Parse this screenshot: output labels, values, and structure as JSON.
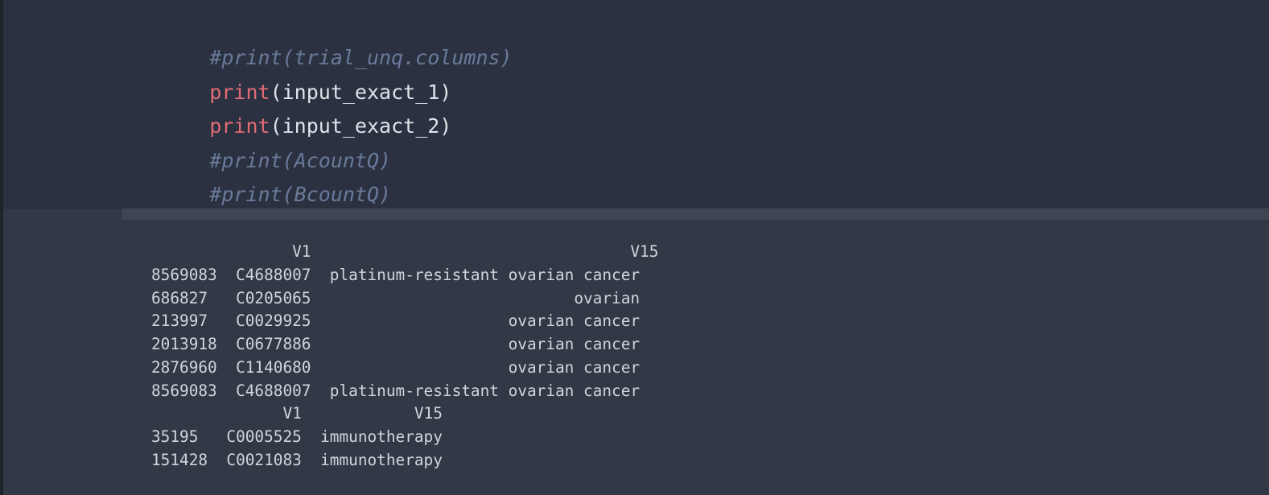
{
  "code": {
    "lines": [
      {
        "comment": "#print(trial_unq.columns)"
      },
      {
        "fn": "print",
        "rest": "(input_exact_1)"
      },
      {
        "fn": "print",
        "rest": "(input_exact_2)"
      },
      {
        "comment": "#print(AcountQ)"
      },
      {
        "comment": "#print(BcountQ)"
      }
    ]
  },
  "output": {
    "lines": [
      "               V1                                  V15",
      "8569083  C4688007  platinum-resistant ovarian cancer",
      "686827   C0205065                            ovarian",
      "213997   C0029925                     ovarian cancer",
      "2013918  C0677886                     ovarian cancer",
      "2876960  C1140680                     ovarian cancer",
      "8569083  C4688007  platinum-resistant ovarian cancer",
      "              V1            V15",
      "35195   C0005525  immunotherapy",
      "151428  C0021083  immunotherapy"
    ]
  },
  "colors": {
    "code_bg": "#2b3140",
    "output_bg": "#323846",
    "comment": "#6a7a9a",
    "keyword": "#e06c75",
    "text": "#dfe3ea"
  }
}
